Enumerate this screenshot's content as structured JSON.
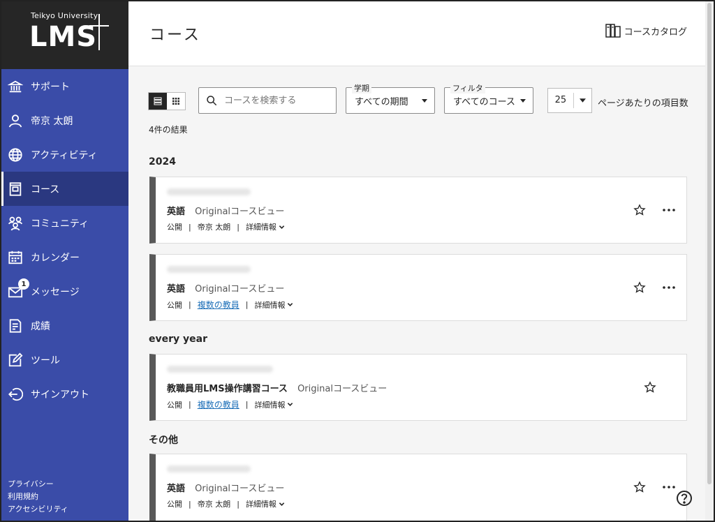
{
  "logo": {
    "top": "Teikyo University",
    "main": "LMS"
  },
  "sidebar": {
    "items": [
      {
        "label": "サポート",
        "icon": "institution-icon"
      },
      {
        "label": "帝京 太朗",
        "icon": "user-icon"
      },
      {
        "label": "アクティビティ",
        "icon": "globe-icon"
      },
      {
        "label": "コース",
        "icon": "course-icon"
      },
      {
        "label": "コミュニティ",
        "icon": "community-icon"
      },
      {
        "label": "カレンダー",
        "icon": "calendar-icon"
      },
      {
        "label": "メッセージ",
        "icon": "mail-icon",
        "badge": "1"
      },
      {
        "label": "成績",
        "icon": "grades-icon"
      },
      {
        "label": "ツール",
        "icon": "tools-icon"
      },
      {
        "label": "サインアウト",
        "icon": "sign-out-icon"
      }
    ],
    "footer": [
      "プライバシー",
      "利用規約",
      "アクセシビリティ"
    ]
  },
  "header": {
    "title": "コース",
    "catalog_label": "コースカタログ"
  },
  "toolbar": {
    "search_placeholder": "コースを検索する",
    "term_legend": "学期",
    "term_value": "すべての期間",
    "filter_legend": "フィルタ",
    "filter_value": "すべてのコース",
    "per_page_value": "25",
    "per_page_label": "ページあたりの項目数"
  },
  "results_text": "4件の結果",
  "groups": [
    {
      "title": "2024",
      "courses": [
        {
          "name": "英語",
          "view": "Originalコースビュー",
          "status": "公開",
          "instructor": "帝京 太朗",
          "instructor_link": false,
          "detail": "詳細情報"
        },
        {
          "name": "英語",
          "view": "Originalコースビュー",
          "status": "公開",
          "instructor": "複数の教員",
          "instructor_link": true,
          "detail": "詳細情報"
        }
      ]
    },
    {
      "title": "every year",
      "courses": [
        {
          "name": "教職員用LMS操作講習コース",
          "view": "Originalコースビュー",
          "status": "公開",
          "instructor": "複数の教員",
          "instructor_link": true,
          "detail": "詳細情報"
        }
      ]
    },
    {
      "title": "その他",
      "courses": [
        {
          "name": "英語",
          "view": "Originalコースビュー",
          "status": "公開",
          "instructor": "帝京 太朗",
          "instructor_link": false,
          "detail": "詳細情報"
        }
      ]
    }
  ],
  "colors": {
    "sidebar": "#3a4ca8",
    "sidebar_active": "#2a3880",
    "logo_bg": "#262626",
    "link": "#1d6fb8"
  }
}
